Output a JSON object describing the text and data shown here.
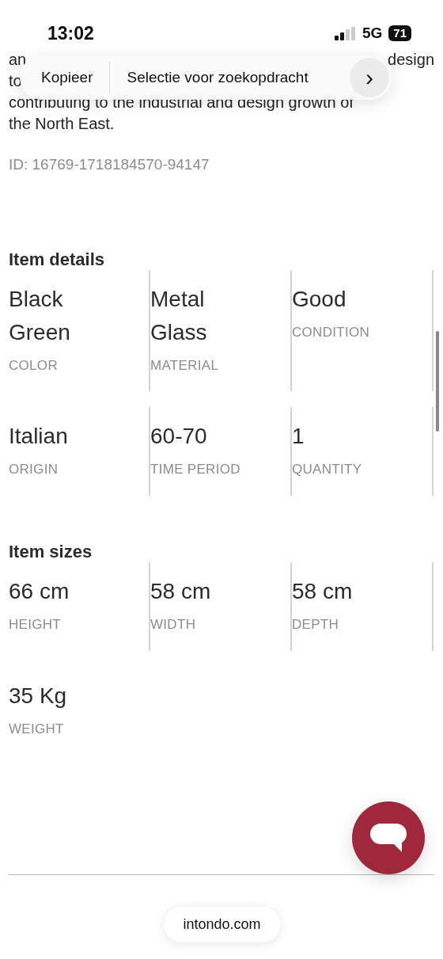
{
  "status_bar": {
    "time": "13:02",
    "network": "5G",
    "battery": "71"
  },
  "text_menu": {
    "items": [
      "Kopieer",
      "Selectie voor zoekopdracht"
    ],
    "more": "›"
  },
  "description": {
    "lines": [
      {
        "left": "an",
        "right": "design"
      },
      {
        "left": "to"
      },
      {
        "left": "contributing to the industrial and design growth of"
      },
      {
        "left": "the North East."
      }
    ]
  },
  "item_id": "ID: 16769-1718184570-94147",
  "sections": [
    {
      "title": "Item details",
      "cells": [
        {
          "values": [
            "Black",
            "Green"
          ],
          "label": "COLOR"
        },
        {
          "values": [
            "Metal",
            "Glass"
          ],
          "label": "MATERIAL"
        },
        {
          "values": [
            "Good"
          ],
          "label": "CONDITION"
        },
        {
          "values": [
            "Italian"
          ],
          "label": "ORIGIN"
        },
        {
          "values": [
            "60-70"
          ],
          "label": "TIME PERIOD"
        },
        {
          "values": [
            "1"
          ],
          "label": "QUANTITY"
        }
      ]
    },
    {
      "title": "Item sizes",
      "cells": [
        {
          "values": [
            "66 cm"
          ],
          "label": "HEIGHT"
        },
        {
          "values": [
            "58 cm"
          ],
          "label": "WIDTH"
        },
        {
          "values": [
            "58 cm"
          ],
          "label": "DEPTH"
        },
        {
          "values": [
            "35 Kg"
          ],
          "label": "WEIGHT"
        }
      ]
    }
  ],
  "url": "intondo.com"
}
